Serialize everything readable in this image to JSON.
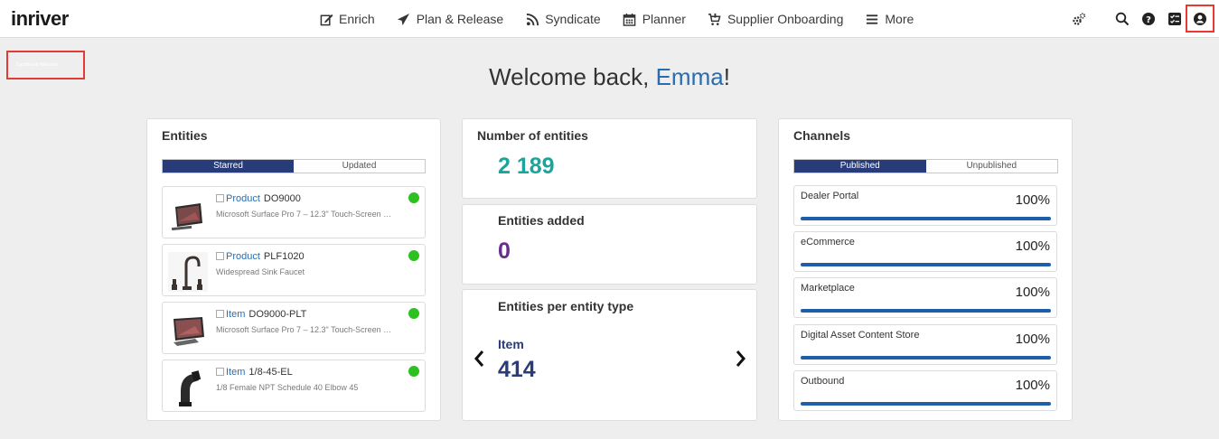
{
  "app": {
    "logo": "inriver"
  },
  "nav": {
    "items": [
      {
        "label": "Enrich",
        "icon": "edit-icon"
      },
      {
        "label": "Plan & Release",
        "icon": "send-icon"
      },
      {
        "label": "Syndicate",
        "icon": "rss-icon"
      },
      {
        "label": "Planner",
        "icon": "calendar-icon"
      },
      {
        "label": "Supplier Onboarding",
        "icon": "cart-icon"
      },
      {
        "label": "More",
        "icon": "hamburger-icon"
      }
    ]
  },
  "tools": [
    "settings-icon",
    "search-icon",
    "help-icon",
    "tasks-icon",
    "user-icon"
  ],
  "highlight_label": "Dashboard Welcome",
  "welcome": {
    "prefix": "Welcome back, ",
    "name": "Emma",
    "suffix": "!"
  },
  "entities": {
    "title": "Entities",
    "tabs": {
      "active": "Starred",
      "inactive": "Updated"
    },
    "items": [
      {
        "type": "Product",
        "code": "DO9000",
        "description": "Microsoft Surface Pro 7 – 12.3\" Touch-Screen …",
        "thumb": "tablet"
      },
      {
        "type": "Product",
        "code": "PLF1020",
        "description": "Widespread Sink Faucet",
        "thumb": "faucet"
      },
      {
        "type": "Item",
        "code": "DO9000-PLT",
        "description": "Microsoft Surface Pro 7 – 12.3\" Touch-Screen …",
        "thumb": "tablet"
      },
      {
        "type": "Item",
        "code": "1/8-45-EL",
        "description": "1/8 Female NPT Schedule 40 Elbow 45",
        "thumb": "elbow"
      }
    ]
  },
  "stats": {
    "count_title": "Number of entities",
    "count_value": "2 189",
    "count_color": "#1aa59a",
    "added_title": "Entities added",
    "added_value": "0",
    "added_color": "#6a2c8f",
    "per_type_title": "Entities per entity type",
    "per_type_label": "Item",
    "per_type_value": "414",
    "per_type_color": "#283c7a"
  },
  "channels": {
    "title": "Channels",
    "tabs": {
      "active": "Published",
      "inactive": "Unpublished"
    },
    "items": [
      {
        "name": "Dealer Portal",
        "percent_label": "100%",
        "progress": 1.0
      },
      {
        "name": "eCommerce",
        "percent_label": "100%",
        "progress": 1.0
      },
      {
        "name": "Marketplace",
        "percent_label": "100%",
        "progress": 1.0
      },
      {
        "name": "Digital Asset Content Store",
        "percent_label": "100%",
        "progress": 1.0
      },
      {
        "name": "Outbound",
        "percent_label": "100%",
        "progress": 1.0
      }
    ]
  }
}
